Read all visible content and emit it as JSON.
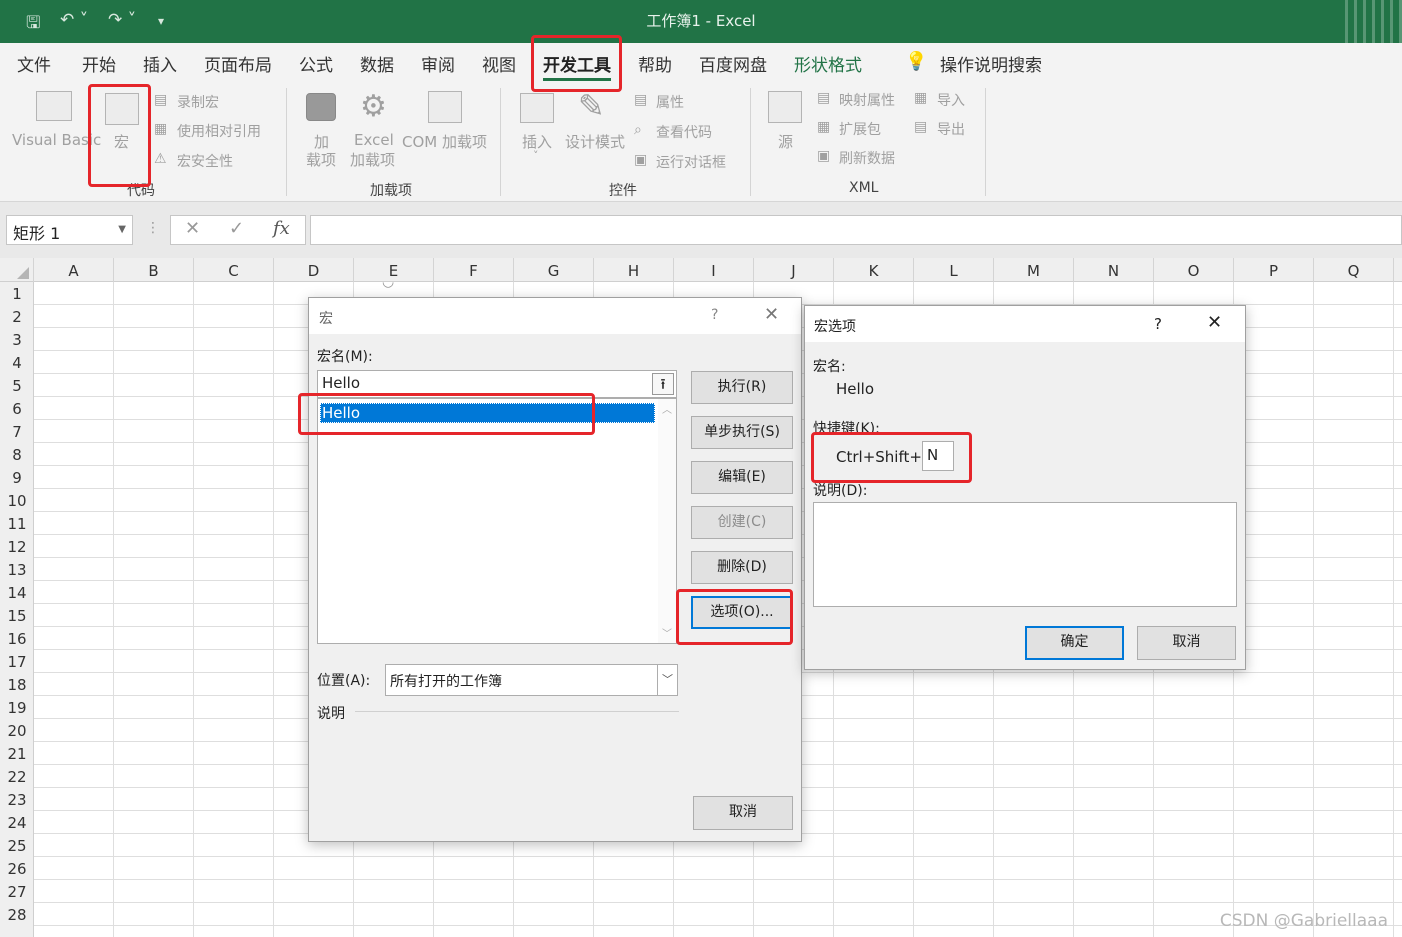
{
  "titlebar": {
    "title": "工作簿1  -  Excel"
  },
  "tabs": [
    "文件",
    "开始",
    "插入",
    "页面布局",
    "公式",
    "数据",
    "审阅",
    "视图",
    "开发工具",
    "帮助",
    "百度网盘",
    "形状格式"
  ],
  "tell_me": "操作说明搜索",
  "ribbon": {
    "code": {
      "visual_basic": "Visual Basic",
      "macros": "宏",
      "record": "录制宏",
      "relative": "使用相对引用",
      "security": "宏安全性",
      "group": "代码"
    },
    "addins": {
      "addins_l1": "加",
      "addins_l2": "载项",
      "excel_l1": "Excel",
      "excel_l2": "加载项",
      "com": "COM 加载项",
      "group": "加载项"
    },
    "controls": {
      "insert": "插入",
      "design": "设计模式",
      "properties": "属性",
      "view_code": "查看代码",
      "run_dialog": "运行对话框",
      "group": "控件"
    },
    "xml": {
      "source": "源",
      "map_props": "映射属性",
      "expansion": "扩展包",
      "refresh": "刷新数据",
      "import": "导入",
      "export": "导出",
      "group": "XML"
    }
  },
  "formula_bar": {
    "name_box": "矩形 1",
    "fx": "fx"
  },
  "columns": [
    "A",
    "B",
    "C",
    "D",
    "E",
    "F",
    "G",
    "H",
    "I",
    "J",
    "K",
    "L",
    "M",
    "N",
    "O",
    "P",
    "Q"
  ],
  "rows": [
    "1",
    "2",
    "3",
    "4",
    "5",
    "6",
    "7",
    "8",
    "9",
    "10",
    "11",
    "12",
    "13",
    "14",
    "15",
    "16",
    "17",
    "18",
    "19",
    "20",
    "21",
    "22",
    "23",
    "24",
    "25",
    "26",
    "27",
    "28"
  ],
  "macro_dialog": {
    "title": "宏",
    "help": "?",
    "macro_name_label": "宏名(M):",
    "macro_name_value": "Hello",
    "list_items": [
      "Hello"
    ],
    "buttons": {
      "run": "执行(R)",
      "step": "单步执行(S)",
      "edit": "编辑(E)",
      "create": "创建(C)",
      "delete": "删除(D)",
      "options": "选项(O)...",
      "cancel": "取消"
    },
    "location_label": "位置(A):",
    "location_value": "所有打开的工作簿",
    "description_label": "说明"
  },
  "options_dialog": {
    "title": "宏选项",
    "help": "?",
    "macro_name_label": "宏名:",
    "macro_name_value": "Hello",
    "shortcut_label": "快捷键(K):",
    "shortcut_prefix": "Ctrl+Shift+",
    "shortcut_key": "N",
    "description_label": "说明(D):",
    "ok": "确定",
    "cancel": "取消"
  },
  "watermark": "CSDN @Gabriellaaa",
  "colors": {
    "excel_green": "#217346",
    "highlight_red": "#e5252a",
    "selection_blue": "#0078d7"
  }
}
